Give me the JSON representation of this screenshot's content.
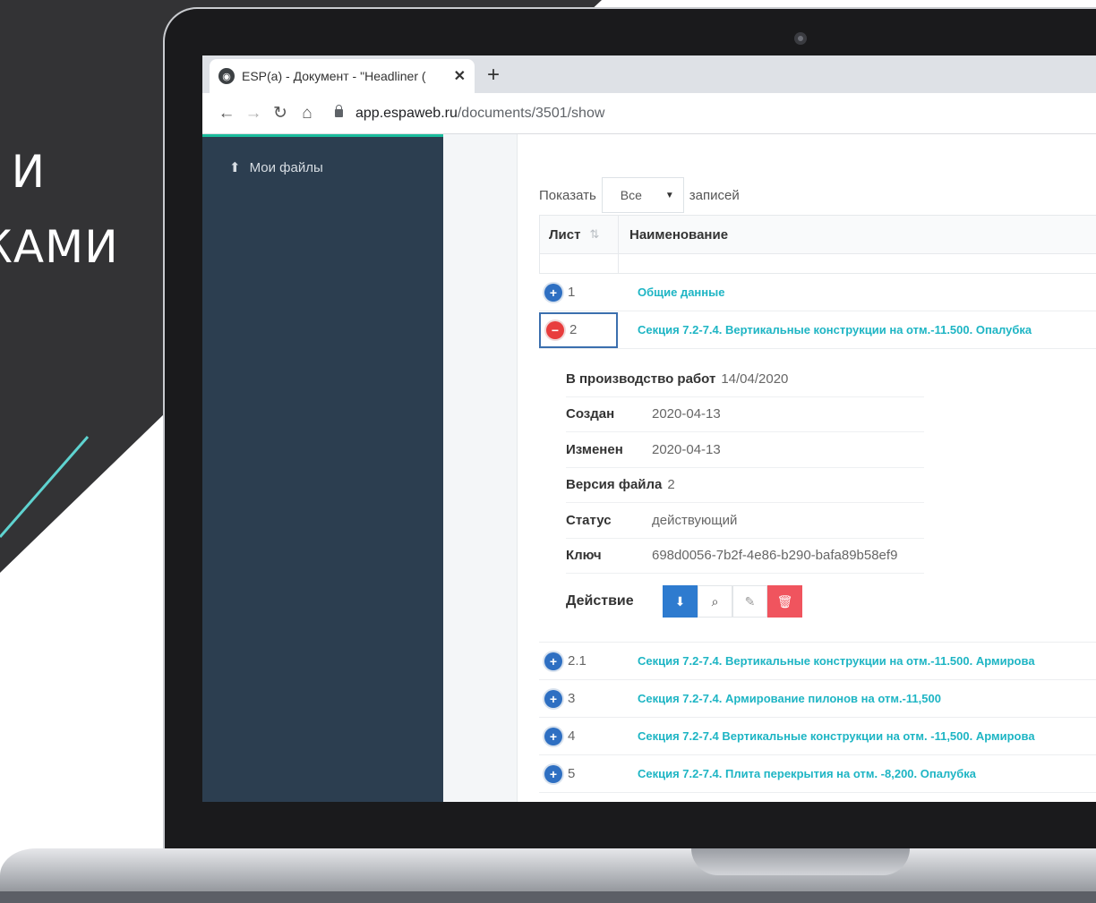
{
  "slide": {
    "title_line1": "Я И",
    "title_line2": "ЖАМИ",
    "colors": {
      "dark": "#333335",
      "accent": "#5fd3d0"
    }
  },
  "browser": {
    "tab_title": "ESP(a) - Документ - \"Headliner (",
    "tab_close": "✕",
    "new_tab": "+",
    "url_domain": "app.espaweb.ru",
    "url_path": "/documents/3501/show"
  },
  "sidebar": {
    "items": [
      {
        "label": "Мои файлы",
        "icon": "upload-icon"
      }
    ]
  },
  "table_controls": {
    "show_label": "Показать",
    "page_size": "Все",
    "records_label": "записей"
  },
  "table": {
    "headers": {
      "sheet": "Лист",
      "name": "Наименование"
    },
    "rows_top": [
      {
        "num": "1",
        "name": "Общие данные",
        "expanded": false
      },
      {
        "num": "2",
        "name": "Секция 7.2-7.4. Вертикальные конструкции на отм.-11.500. Опалубка",
        "expanded": true
      }
    ],
    "details": {
      "production_label": "В производство работ",
      "production_value": "14/04/2020",
      "created_label": "Создан",
      "created_value": "2020-04-13",
      "modified_label": "Изменен",
      "modified_value": "2020-04-13",
      "version_label": "Версия файла",
      "version_value": "2",
      "status_label": "Статус",
      "status_value": "действующий",
      "key_label": "Ключ",
      "key_value": "698d0056-7b2f-4e86-b290-bafa89b58ef9",
      "action_label": "Действие"
    },
    "rows_bottom": [
      {
        "num": "2.1",
        "name": "Секция 7.2-7.4. Вертикальные конструкции на отм.-11.500. Армирова"
      },
      {
        "num": "3",
        "name": "Секция 7.2-7.4. Армирование пилонов на отм.-11,500"
      },
      {
        "num": "4",
        "name": "Секция 7.2-7.4 Вертикальные конструкции на отм. -11,500. Армирова"
      },
      {
        "num": "5",
        "name": "Секция 7.2-7.4. Плита перекрытия на отм. -8,200. Опалубка"
      }
    ]
  },
  "colors": {
    "sidebar_bg": "#2c3e50",
    "link": "#1eb5c4",
    "expand_blue": "#2e6fc2",
    "collapse_red": "#e83d3d",
    "download_blue": "#2e7bcf",
    "delete_red": "#f0545e"
  }
}
